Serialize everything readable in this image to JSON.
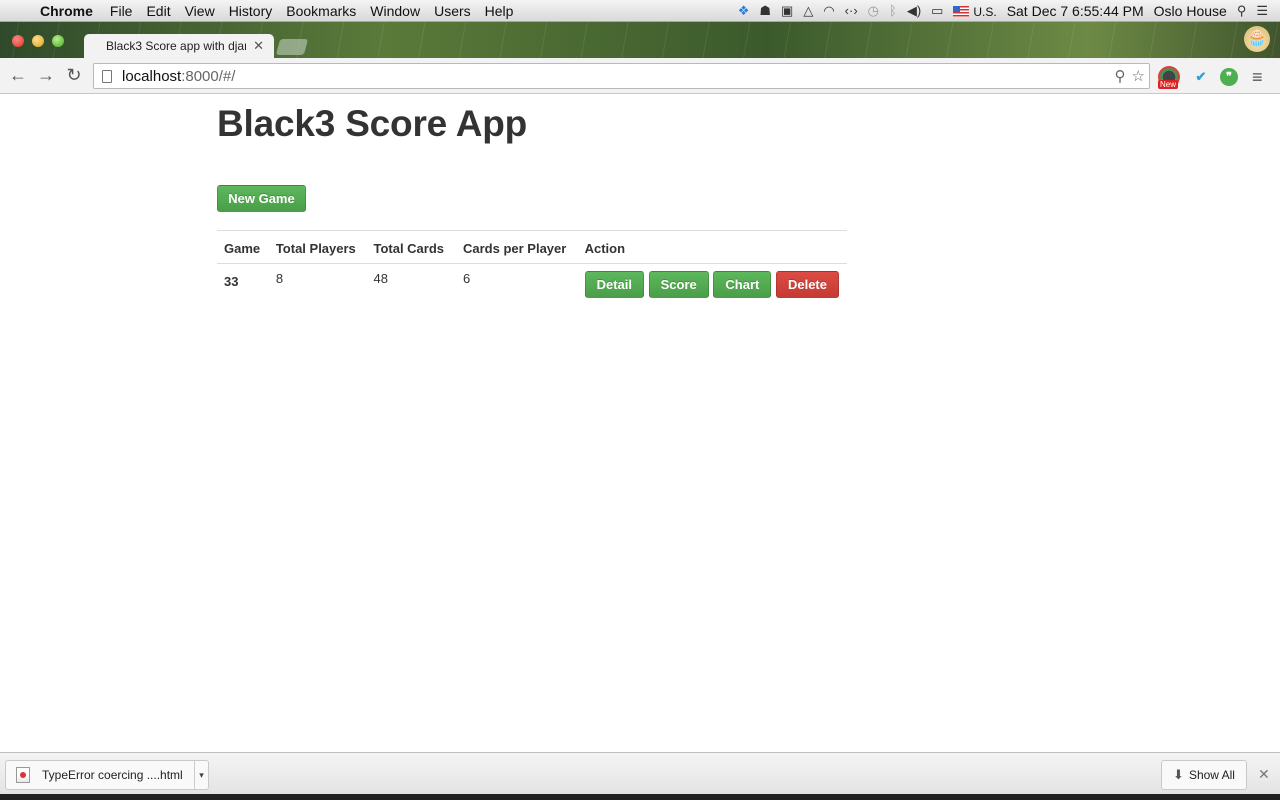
{
  "menubar": {
    "app_name": "Chrome",
    "items": [
      "File",
      "Edit",
      "View",
      "History",
      "Bookmarks",
      "Window",
      "Users",
      "Help"
    ],
    "input_source": "U.S.",
    "datetime": "Sat Dec 7  6:55:44 PM",
    "user": "Oslo House"
  },
  "browser": {
    "tab_title": "Black3 Score app with djan",
    "url_host": "localhost",
    "url_rest": ":8000/#/",
    "extension_badge": "New"
  },
  "page": {
    "title": "Black3 Score App",
    "new_game_label": "New Game",
    "table": {
      "headers": [
        "Game",
        "Total Players",
        "Total Cards",
        "Cards per Player",
        "Action"
      ],
      "rows": [
        {
          "game": "33",
          "total_players": "8",
          "total_cards": "48",
          "cards_per_player": "6"
        }
      ],
      "actions": {
        "detail": "Detail",
        "score": "Score",
        "chart": "Chart",
        "delete": "Delete"
      }
    }
  },
  "downloads": {
    "file_name": "TypeError  coercing ....html",
    "show_all_label": "Show All"
  },
  "colors": {
    "btn_success": "#4cae4c",
    "btn_danger": "#d43f3a",
    "title_text": "#333333"
  },
  "icons": [
    "apple-icon",
    "dropbox-icon",
    "evernote-icon",
    "terminal-icon",
    "drive-icon",
    "wifi-icon",
    "code-icon",
    "time-machine-icon",
    "bluetooth-icon",
    "volume-icon",
    "battery-icon",
    "spotlight-icon",
    "list-icon",
    "back-icon",
    "forward-icon",
    "reload-icon",
    "page-icon",
    "search-icon",
    "star-icon",
    "menu-icon",
    "download-icon",
    "close-icon"
  ]
}
